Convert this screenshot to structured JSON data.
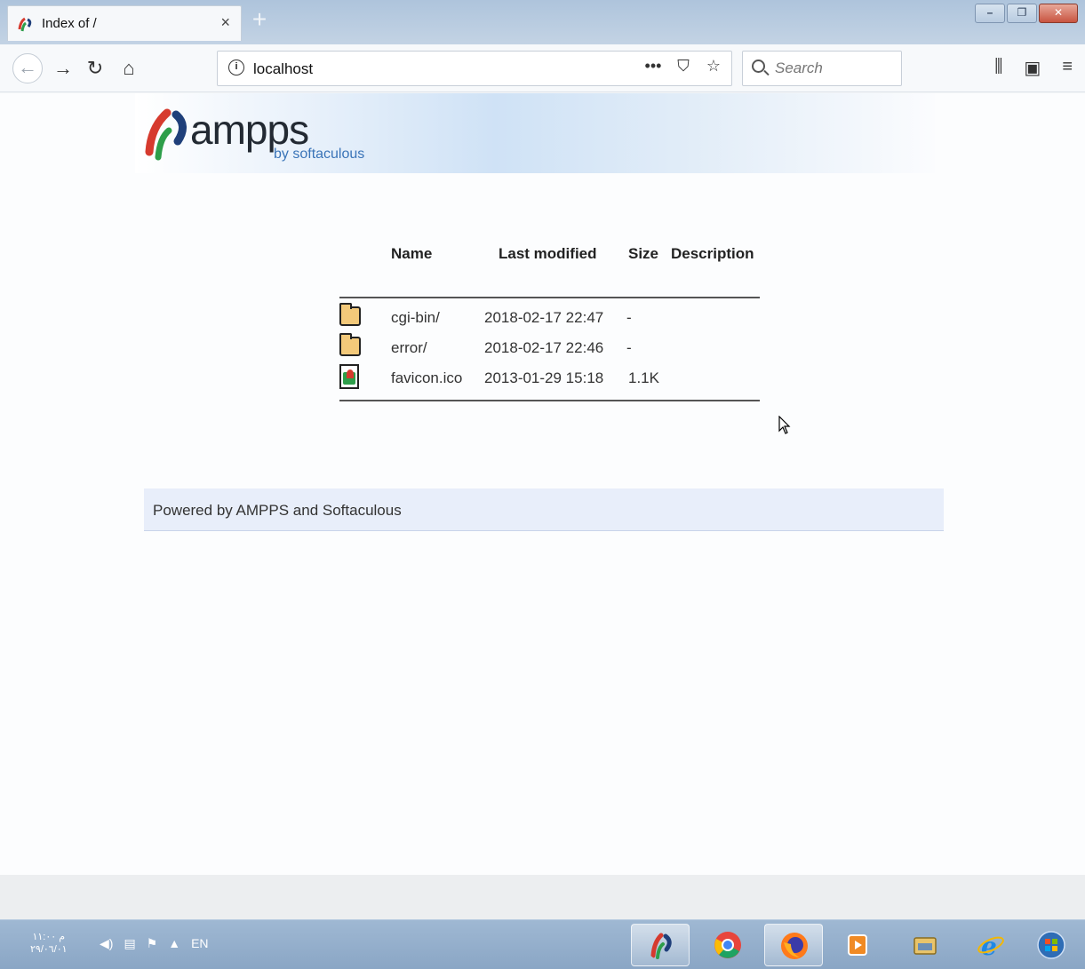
{
  "browser": {
    "tab_title": "Index of /",
    "tab_close": "×",
    "new_tab": "+",
    "window_controls": {
      "minimize": "–",
      "restore": "❐",
      "close": "✕"
    },
    "nav": {
      "back": "←",
      "forward": "→",
      "reload": "↻",
      "home": "⌂"
    },
    "url": "localhost",
    "url_info": "i",
    "url_actions": {
      "more": "•••",
      "pocket": "⛉",
      "bookmark": "☆"
    },
    "search_placeholder": "Search",
    "toolbar": {
      "library": "⫼",
      "sidebar": "▣",
      "menu": "≡"
    }
  },
  "page": {
    "logo_word": "ampps",
    "logo_sub": "by softaculous",
    "columns": {
      "name": "Name",
      "modified": "Last modified",
      "size": "Size",
      "description": "Description"
    },
    "rows": [
      {
        "name": "cgi-bin/",
        "modified": "2018-02-17 22:47",
        "size": "-",
        "description": "",
        "icon": "folder-icon"
      },
      {
        "name": "error/",
        "modified": "2018-02-17 22:46",
        "size": "-",
        "description": "",
        "icon": "folder-icon"
      },
      {
        "name": "favicon.ico",
        "modified": "2013-01-29 15:18",
        "size": "1.1K",
        "description": "",
        "icon": "image-file-icon"
      }
    ],
    "footer": "Powered by AMPPS and Softaculous"
  },
  "taskbar": {
    "clock_time": "م ١١:٠٠",
    "clock_date": "٢٩/٠٦/٠١",
    "language": "EN",
    "tray_icons": [
      "volume-icon",
      "network-icon",
      "action-center-icon",
      "show-hidden-icons"
    ],
    "apps": [
      "ampps-icon",
      "chrome-icon",
      "firefox-icon",
      "media-player-icon",
      "file-explorer-icon",
      "internet-explorer-icon",
      "start-icon"
    ]
  },
  "colors": {
    "accent": "#3a74b8",
    "titlebar": "#aec4dc",
    "footer_bg": "#e8eefa"
  }
}
